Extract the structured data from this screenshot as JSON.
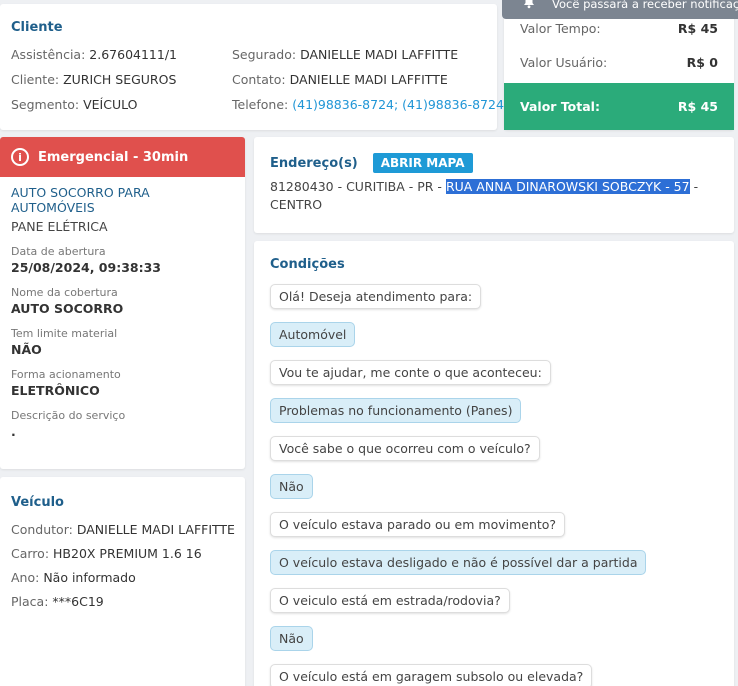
{
  "notification": {
    "text": "Você passará a receber notificações"
  },
  "cliente": {
    "title": "Cliente",
    "assistencia_label": "Assistência:",
    "assistencia": "2.67604111/1",
    "cliente_label": "Cliente:",
    "cliente": "ZURICH SEGUROS",
    "segmento_label": "Segmento:",
    "segmento": "VEÍCULO",
    "segurado_label": "Segurado:",
    "segurado": "DANIELLE MADI LAFFITTE",
    "contato_label": "Contato:",
    "contato": "DANIELLE MADI LAFFITTE",
    "telefone_label": "Telefone:",
    "telefone": "(41)98836-8724; (41)98836-8724"
  },
  "valores": {
    "tempo_label": "Valor Tempo:",
    "tempo": "R$ 45",
    "usuario_label": "Valor Usuário:",
    "usuario": "R$ 0",
    "total_label": "Valor Total:",
    "total": "R$ 45"
  },
  "servico": {
    "emergencia": "Emergencial - 30min",
    "title": "AUTO SOCORRO PARA AUTOMÓVEIS",
    "subtitle": "PANE ELÉTRICA",
    "fields": [
      {
        "label": "Data de abertura",
        "value": "25/08/2024, 09:38:33"
      },
      {
        "label": "Nome da cobertura",
        "value": "AUTO SOCORRO"
      },
      {
        "label": "Tem limite material",
        "value": "NÃO"
      },
      {
        "label": "Forma acionamento",
        "value": "ELETRÔNICO"
      },
      {
        "label": "Descrição do serviço",
        "value": "."
      }
    ]
  },
  "veiculo": {
    "title": "Veículo",
    "condutor_label": "Condutor:",
    "condutor": "DANIELLE MADI LAFFITTE",
    "carro_label": "Carro:",
    "carro": "HB20X PREMIUM 1.6 16",
    "ano_label": "Ano:",
    "ano": "Não informado",
    "placa_label": "Placa:",
    "placa": "***6C19"
  },
  "endereco": {
    "title": "Endereço(s)",
    "map_button": "ABRIR MAPA",
    "prefix": "81280430 - CURITIBA - PR -",
    "highlight": "RUA ANNA DINAROWSKI SOBCZYK - 57",
    "suffix": "-",
    "line2": "CENTRO"
  },
  "condicoes": {
    "title": "Condições",
    "messages": [
      {
        "type": "q",
        "text": "Olá! Deseja atendimento para:"
      },
      {
        "type": "a",
        "text": "Automóvel"
      },
      {
        "type": "q",
        "text": "Vou te ajudar, me conte o que aconteceu:"
      },
      {
        "type": "a",
        "text": "Problemas no funcionamento (Panes)"
      },
      {
        "type": "q",
        "text": "Você sabe o que ocorreu com o veículo?"
      },
      {
        "type": "a",
        "text": "Não"
      },
      {
        "type": "q",
        "text": "O veículo estava parado ou em movimento?"
      },
      {
        "type": "a",
        "text": "O veículo estava desligado e não é possível dar a partida"
      },
      {
        "type": "q",
        "text": "O veiculo está em estrada/rodovia?"
      },
      {
        "type": "a",
        "text": "Não"
      },
      {
        "type": "q",
        "text": "O veículo está em garagem subsolo ou elevada?"
      }
    ]
  }
}
